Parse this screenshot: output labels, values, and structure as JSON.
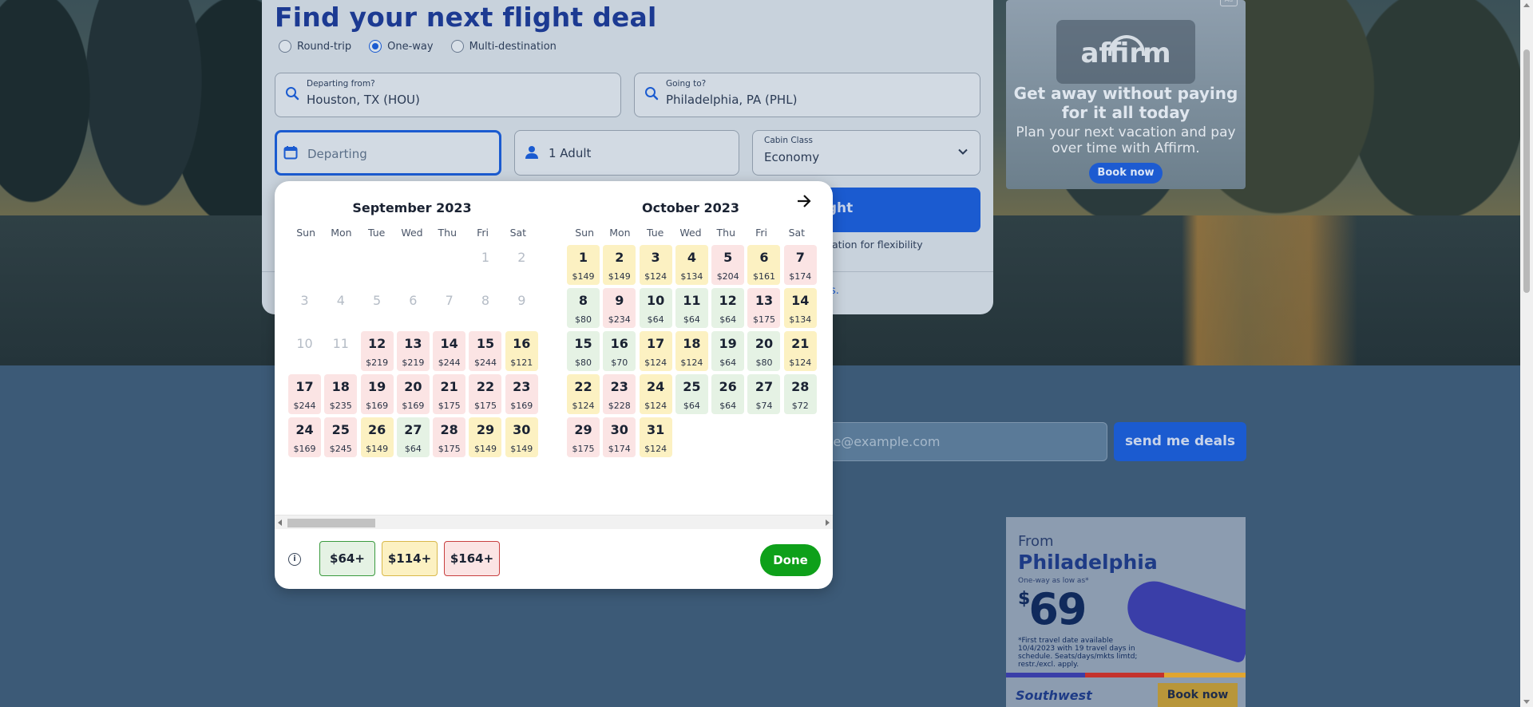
{
  "search": {
    "title": "Find your next flight deal",
    "trip_types": [
      "Round-trip",
      "One-way",
      "Multi-destination"
    ],
    "selected_trip_type": "One-way",
    "from_label": "Departing from?",
    "from_value": "Houston, TX (HOU)",
    "to_label": "Going to?",
    "to_value": "Philadelphia, PA (PHL)",
    "depart_placeholder": "Departing",
    "passengers": "1 Adult",
    "cabin_label": "Cabin Class",
    "cabin_value": "Economy",
    "search_button_partial": "ight",
    "flex_note_partial": "ation for flexibility",
    "card_link_partial": "s."
  },
  "calendar": {
    "weekdays": [
      "Sun",
      "Mon",
      "Tue",
      "Wed",
      "Thu",
      "Fri",
      "Sat"
    ],
    "months": [
      {
        "title": "September 2023",
        "days": [
          {
            "n": "",
            "p": "",
            "c": "e"
          },
          {
            "n": "",
            "p": "",
            "c": "e"
          },
          {
            "n": "",
            "p": "",
            "c": "e"
          },
          {
            "n": "",
            "p": "",
            "c": "e"
          },
          {
            "n": "",
            "p": "",
            "c": "e"
          },
          {
            "n": "1",
            "p": "",
            "c": "dis"
          },
          {
            "n": "2",
            "p": "",
            "c": "dis"
          },
          {
            "n": "3",
            "p": "",
            "c": "dis"
          },
          {
            "n": "4",
            "p": "",
            "c": "dis"
          },
          {
            "n": "5",
            "p": "",
            "c": "dis"
          },
          {
            "n": "6",
            "p": "",
            "c": "dis"
          },
          {
            "n": "7",
            "p": "",
            "c": "dis"
          },
          {
            "n": "8",
            "p": "",
            "c": "dis"
          },
          {
            "n": "9",
            "p": "",
            "c": "dis"
          },
          {
            "n": "10",
            "p": "",
            "c": "dis"
          },
          {
            "n": "11",
            "p": "",
            "c": "dis"
          },
          {
            "n": "12",
            "p": "$219",
            "c": "r"
          },
          {
            "n": "13",
            "p": "$219",
            "c": "r"
          },
          {
            "n": "14",
            "p": "$244",
            "c": "r"
          },
          {
            "n": "15",
            "p": "$244",
            "c": "r"
          },
          {
            "n": "16",
            "p": "$121",
            "c": "y"
          },
          {
            "n": "17",
            "p": "$244",
            "c": "r"
          },
          {
            "n": "18",
            "p": "$235",
            "c": "r"
          },
          {
            "n": "19",
            "p": "$169",
            "c": "r"
          },
          {
            "n": "20",
            "p": "$169",
            "c": "r"
          },
          {
            "n": "21",
            "p": "$175",
            "c": "r"
          },
          {
            "n": "22",
            "p": "$175",
            "c": "r"
          },
          {
            "n": "23",
            "p": "$169",
            "c": "r"
          },
          {
            "n": "24",
            "p": "$169",
            "c": "r"
          },
          {
            "n": "25",
            "p": "$245",
            "c": "r"
          },
          {
            "n": "26",
            "p": "$149",
            "c": "y"
          },
          {
            "n": "27",
            "p": "$64",
            "c": "g"
          },
          {
            "n": "28",
            "p": "$175",
            "c": "r"
          },
          {
            "n": "29",
            "p": "$149",
            "c": "y"
          },
          {
            "n": "30",
            "p": "$149",
            "c": "y"
          }
        ]
      },
      {
        "title": "October 2023",
        "days": [
          {
            "n": "1",
            "p": "$149",
            "c": "y"
          },
          {
            "n": "2",
            "p": "$149",
            "c": "y"
          },
          {
            "n": "3",
            "p": "$124",
            "c": "y"
          },
          {
            "n": "4",
            "p": "$134",
            "c": "y"
          },
          {
            "n": "5",
            "p": "$204",
            "c": "r"
          },
          {
            "n": "6",
            "p": "$161",
            "c": "y"
          },
          {
            "n": "7",
            "p": "$174",
            "c": "r"
          },
          {
            "n": "8",
            "p": "$80",
            "c": "g"
          },
          {
            "n": "9",
            "p": "$234",
            "c": "r"
          },
          {
            "n": "10",
            "p": "$64",
            "c": "g"
          },
          {
            "n": "11",
            "p": "$64",
            "c": "g"
          },
          {
            "n": "12",
            "p": "$64",
            "c": "g"
          },
          {
            "n": "13",
            "p": "$175",
            "c": "r"
          },
          {
            "n": "14",
            "p": "$134",
            "c": "y"
          },
          {
            "n": "15",
            "p": "$80",
            "c": "g"
          },
          {
            "n": "16",
            "p": "$70",
            "c": "g"
          },
          {
            "n": "17",
            "p": "$124",
            "c": "y"
          },
          {
            "n": "18",
            "p": "$124",
            "c": "y"
          },
          {
            "n": "19",
            "p": "$64",
            "c": "g"
          },
          {
            "n": "20",
            "p": "$80",
            "c": "g"
          },
          {
            "n": "21",
            "p": "$124",
            "c": "y"
          },
          {
            "n": "22",
            "p": "$124",
            "c": "y"
          },
          {
            "n": "23",
            "p": "$228",
            "c": "r"
          },
          {
            "n": "24",
            "p": "$124",
            "c": "y"
          },
          {
            "n": "25",
            "p": "$64",
            "c": "g"
          },
          {
            "n": "26",
            "p": "$64",
            "c": "g"
          },
          {
            "n": "27",
            "p": "$74",
            "c": "g"
          },
          {
            "n": "28",
            "p": "$72",
            "c": "g"
          },
          {
            "n": "29",
            "p": "$175",
            "c": "r"
          },
          {
            "n": "30",
            "p": "$174",
            "c": "r"
          },
          {
            "n": "31",
            "p": "$124",
            "c": "y"
          }
        ]
      }
    ],
    "legend": {
      "low": "$64+",
      "mid": "$114+",
      "high": "$164+"
    },
    "done_label": "Done"
  },
  "ads": {
    "affirm": {
      "logo": "affirm",
      "headline": "Get away without paying for it all today",
      "subtext": "Plan your next vacation and pay over time with Affirm.",
      "button": "Book now",
      "ad_tag": "Ad"
    },
    "southwest": {
      "from": "From",
      "city": "Philadelphia",
      "oneway": "One-way as low as*",
      "price": "69",
      "currency": "$",
      "fine_print": "*First travel date available 10/4/2023 with 19 travel days in schedule. Seats/days/mkts limtd; restr./excl. apply.",
      "brand": "Southwest",
      "button": "Book now"
    }
  },
  "newsletter": {
    "email_placeholder_partial": "le@example.com",
    "send_button": "send me deals"
  },
  "colors": {
    "brand_blue": "#1b5bd0",
    "title_blue": "#1c3a92",
    "cheap": "#e5f2e4",
    "mid": "#fcf1c2",
    "expensive": "#fbe4e4",
    "done_green": "#0ea01a"
  }
}
